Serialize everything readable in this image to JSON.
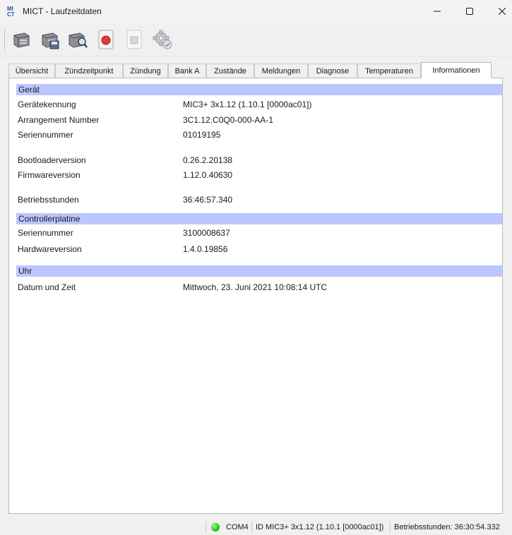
{
  "window": {
    "title": "MICT - Laufzeitdaten",
    "logo_icon": "mict-logo-icon",
    "controls": {
      "minimize": "minimize-icon",
      "maximize": "maximize-icon",
      "close": "close-icon"
    }
  },
  "toolbar": {
    "buttons": [
      {
        "icon": "open-device-icon"
      },
      {
        "icon": "save-device-icon"
      },
      {
        "icon": "search-device-icon"
      },
      {
        "icon": "record-icon"
      },
      {
        "icon": "stop-icon"
      },
      {
        "icon": "settings-gear-icon"
      }
    ]
  },
  "tabs": [
    {
      "label": "Übersicht"
    },
    {
      "label": "Zündzeitpunkt"
    },
    {
      "label": "Zündung"
    },
    {
      "label": "Bank A"
    },
    {
      "label": "Zustände"
    },
    {
      "label": "Meldungen"
    },
    {
      "label": "Diagnose"
    },
    {
      "label": "Temperaturen"
    },
    {
      "label": "Informationen",
      "active": true
    }
  ],
  "panel": {
    "section_color": "#bcc6ff",
    "sections": [
      {
        "title": "Gerät",
        "rows": [
          {
            "label": "Gerätekennung",
            "value": "MIC3+ 3x1.12 (1.10.1 [0000ac01])"
          },
          {
            "label": "Arrangement Number",
            "value": "3C1.12.C0Q0-000-AA-1"
          },
          {
            "label": "Seriennummer",
            "value": "01019195"
          },
          {
            "label": "Bootloaderversion",
            "value": "0.26.2.20138"
          },
          {
            "label": "Firmwareversion",
            "value": "1.12.0.40630"
          },
          {
            "label": "Betriebsstunden",
            "value": "36:46:57.340"
          }
        ]
      },
      {
        "title": "Controllerplatine",
        "rows": [
          {
            "label": "Seriennummer",
            "value": "3100008637"
          },
          {
            "label": "Hardwareversion",
            "value": "1.4.0.19856"
          }
        ]
      },
      {
        "title": "Uhr",
        "rows": [
          {
            "label": "Datum und Zeit",
            "value": "Mittwoch, 23. Juni 2021 10:08:14 UTC"
          }
        ]
      }
    ]
  },
  "statusbar": {
    "connection_color": "#2fc41f",
    "port": "COM4",
    "device_id": "ID MIC3+ 3x1.12 (1.10.1 [0000ac01])",
    "hours": "Betriebsstunden: 36:30:54.332"
  }
}
